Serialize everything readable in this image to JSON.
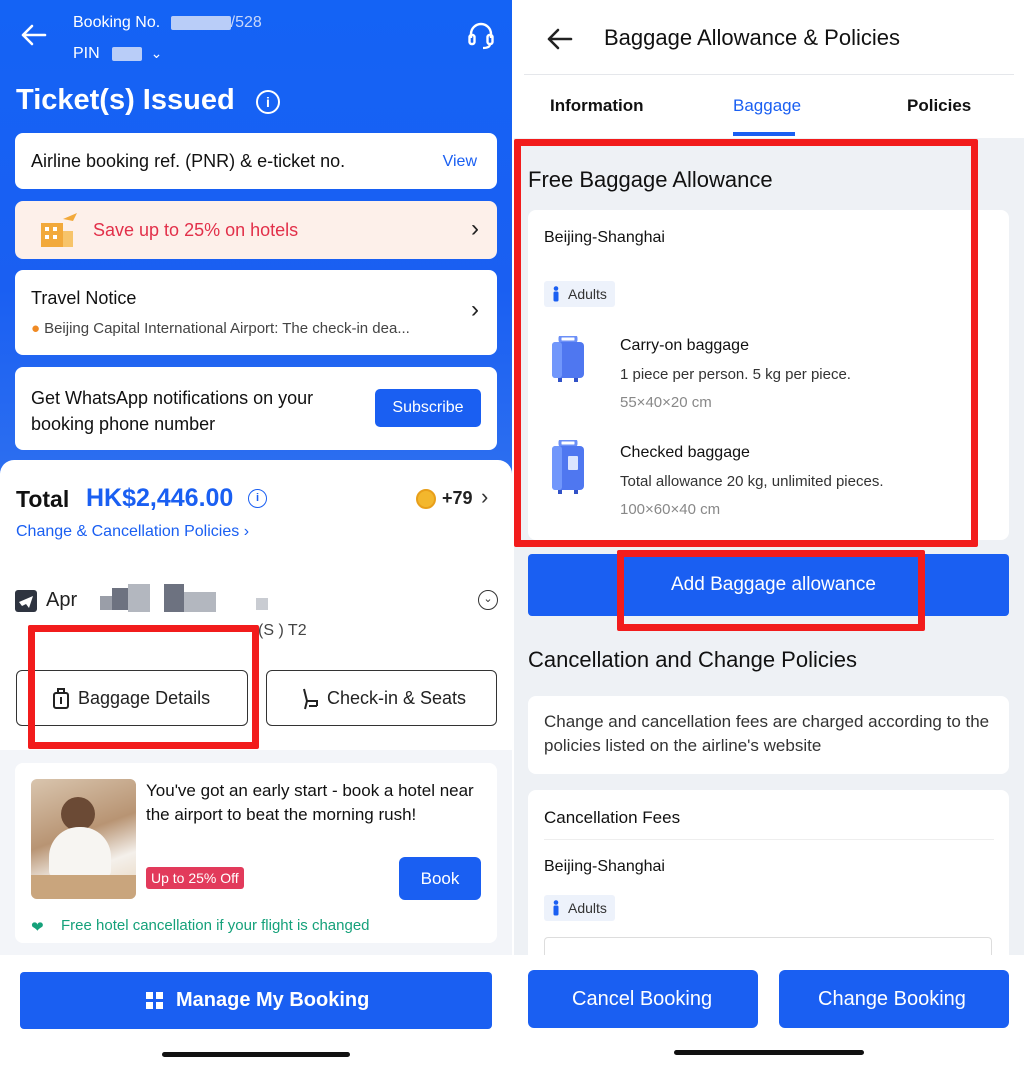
{
  "left": {
    "header": {
      "booking_label": "Booking No.",
      "booking_suffix": "/528",
      "pin_label": "PIN",
      "title": "Ticket(s) Issued"
    },
    "pnr": {
      "text": "Airline booking ref. (PNR) & e-ticket no.",
      "link": "View"
    },
    "hotel_promo": {
      "text": "Save up to 25% on hotels"
    },
    "notice": {
      "title": "Travel Notice",
      "text": "Beijing Capital International Airport: The check-in dea..."
    },
    "whatsapp": {
      "text": "Get WhatsApp notifications on your booking phone number",
      "button": "Subscribe"
    },
    "total": {
      "label": "Total",
      "value": "HK$2,446.00",
      "points": "+79"
    },
    "policy_link": "Change & Cancellation Policies",
    "flight": {
      "date_prefix": "Apr",
      "terminal": "(S    ) T2"
    },
    "buttons": {
      "baggage": "Baggage Details",
      "checkin": "Check-in & Seats"
    },
    "hotel_card": {
      "text": "You've got an early start - book a hotel near the airport to beat the morning rush!",
      "badge": "Up to 25% Off",
      "button": "Book",
      "free_cancel": "Free hotel cancellation if your flight is changed"
    },
    "manage_button": "Manage My Booking"
  },
  "right": {
    "header": {
      "title": "Baggage Allowance & Policies"
    },
    "tabs": [
      "Information",
      "Baggage",
      "Policies"
    ],
    "active_tab": "Baggage",
    "free_allowance": {
      "title": "Free Baggage Allowance",
      "route": "Beijing-Shanghai",
      "passenger": "Adults",
      "carry_on": {
        "title": "Carry-on baggage",
        "desc": "1 piece per person. 5 kg per piece.",
        "dims": "55×40×20 cm"
      },
      "checked": {
        "title": "Checked baggage",
        "desc": "Total allowance 20 kg, unlimited pieces.",
        "dims": "100×60×40 cm"
      }
    },
    "add_button": "Add Baggage allowance",
    "cancellation": {
      "title": "Cancellation and Change Policies",
      "note": "Change and cancellation fees are charged according to the policies listed on the airline's website",
      "fees_title": "Cancellation Fees",
      "route": "Beijing-Shanghai",
      "passenger": "Adults"
    },
    "bottom_buttons": {
      "cancel": "Cancel Booking",
      "change": "Change Booking"
    }
  },
  "colors": {
    "brand_blue": "#1a5ff2",
    "highlight_red": "#f21c1c",
    "promo_red": "#e2304a",
    "green": "#15a17a"
  },
  "icons": [
    "back-arrow-icon",
    "headset-icon",
    "info-icon",
    "chevron-right-icon",
    "hotel-icon",
    "plane-icon",
    "luggage-icon",
    "seat-icon",
    "coin-icon",
    "grid-icon",
    "person-icon",
    "suitcase-icon",
    "heart-icon"
  ]
}
